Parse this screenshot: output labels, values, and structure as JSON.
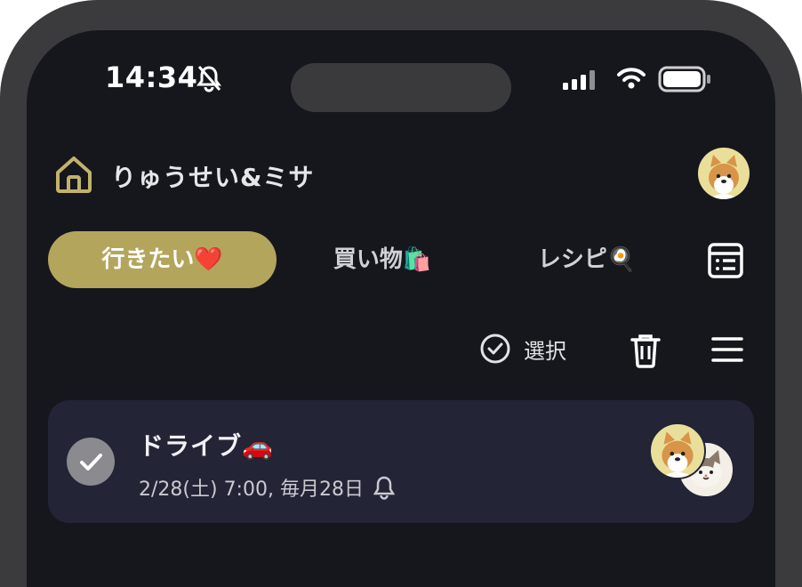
{
  "status_bar": {
    "time": "14:34",
    "icons": [
      "bell-slash-icon",
      "cellular-signal-icon",
      "wifi-icon",
      "battery-icon"
    ]
  },
  "header": {
    "title": "りゅうせい&ミサ",
    "icon": "home-icon"
  },
  "tabs": [
    {
      "label": "行きたい❤️",
      "active": true
    },
    {
      "label": "買い物🛍️",
      "active": false
    },
    {
      "label": "レシピ🍳",
      "active": false
    }
  ],
  "toolbar": {
    "select_label": "選択",
    "icons": [
      "check-circle-icon",
      "trash-icon",
      "menu-icon",
      "list-view-icon"
    ]
  },
  "tasks": [
    {
      "title": "ドライブ🚗",
      "meta": "2/28(土) 7:00, 毎月28日",
      "reminder_icon": "bell-icon",
      "assignees": [
        "shiba-dog-avatar",
        "cat-avatar"
      ]
    }
  ],
  "colors": {
    "background": "#16171d",
    "accent": "#b3a55c",
    "card": "#232436"
  }
}
